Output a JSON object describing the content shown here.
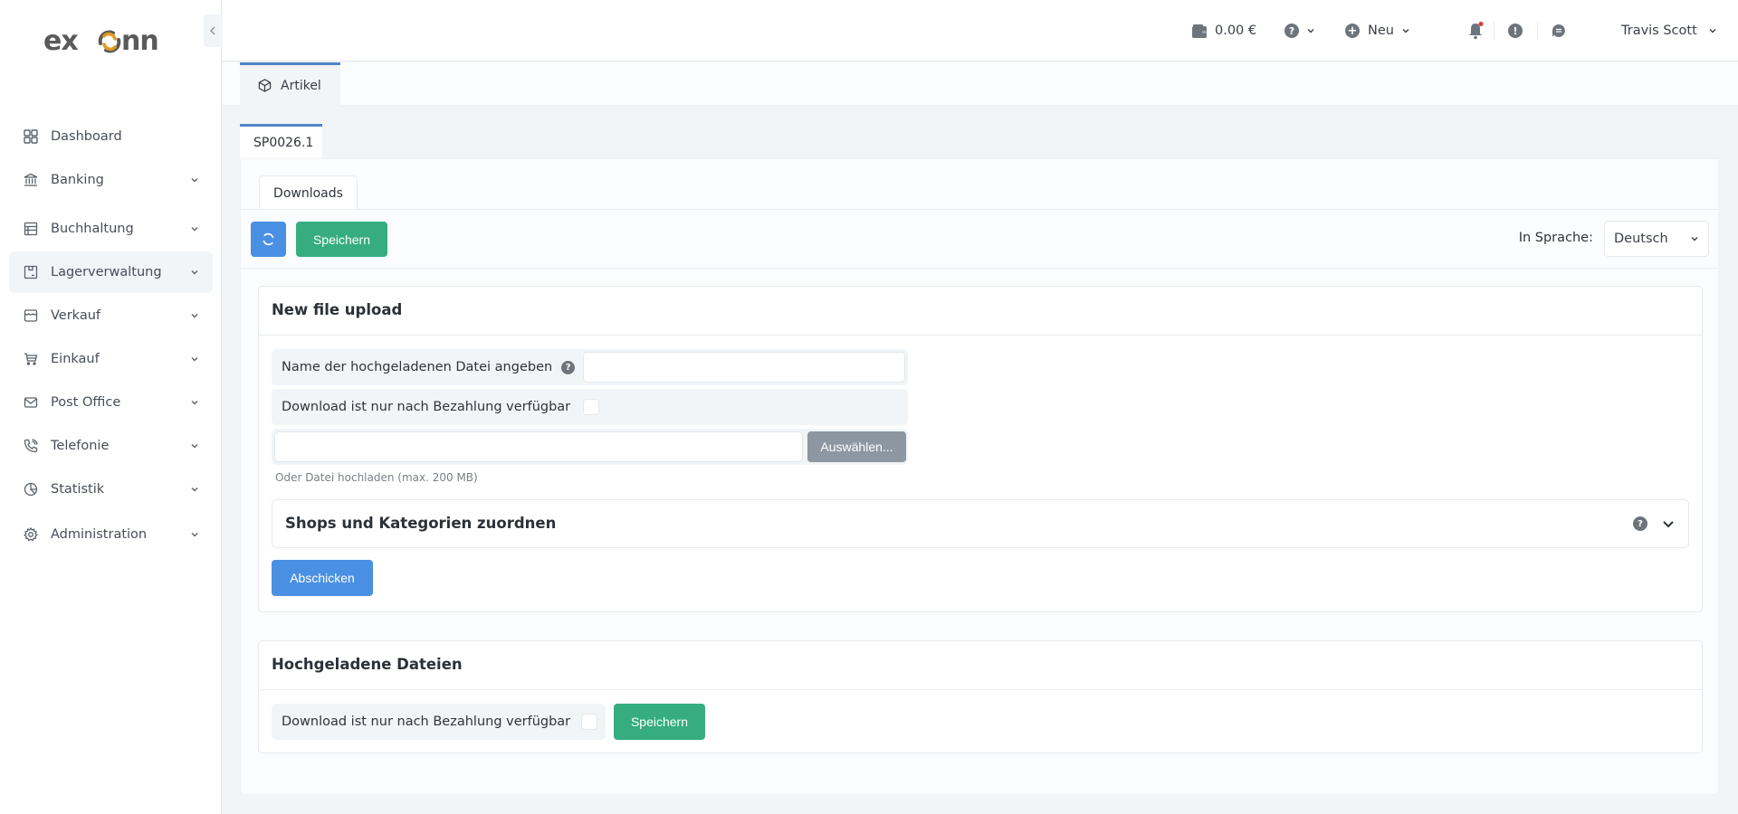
{
  "app": {
    "logo_text": "exonn",
    "brand_colors": {
      "logo_gray": "#5a5a5c",
      "logo_orange": "#e39a1c",
      "accent_blue": "#4a90e2",
      "success_green": "#35ad80"
    }
  },
  "sidebar": {
    "collapse_icon": "chevron-left-icon",
    "items": [
      {
        "label": "Dashboard",
        "icon": "grid-icon",
        "has_submenu": false,
        "active": false
      },
      {
        "label": "Banking",
        "icon": "bank-icon",
        "has_submenu": true,
        "active": false
      },
      {
        "label": "Buchhaltung",
        "icon": "ledger-icon",
        "has_submenu": true,
        "active": false
      },
      {
        "label": "Lagerverwaltung",
        "icon": "warehouse-box-icon",
        "has_submenu": true,
        "active": true
      },
      {
        "label": "Verkauf",
        "icon": "storefront-icon",
        "has_submenu": true,
        "active": false
      },
      {
        "label": "Einkauf",
        "icon": "cart-icon",
        "has_submenu": true,
        "active": false
      },
      {
        "label": "Post Office",
        "icon": "mail-icon",
        "has_submenu": true,
        "active": false
      },
      {
        "label": "Telefonie",
        "icon": "phone-icon",
        "has_submenu": true,
        "active": false
      },
      {
        "label": "Statistik",
        "icon": "pie-chart-icon",
        "has_submenu": true,
        "active": false
      },
      {
        "label": "Administration",
        "icon": "gear-icon",
        "has_submenu": true,
        "active": false
      }
    ]
  },
  "topbar": {
    "balance": "0.00 €",
    "help_icon": "question-circle-icon",
    "new_label": "Neu",
    "notification_has_badge": true,
    "user_name": "Travis Scott"
  },
  "tabs": {
    "main_tab": "Artikel",
    "sub_tab": "SP0026.1",
    "inner_tab": "Downloads"
  },
  "toolbar": {
    "save_label": "Speichern",
    "language_label": "In Sprache:",
    "language_value": "Deutsch"
  },
  "upload_card": {
    "title": "New file upload",
    "name_label": "Name der hochgeladenen Datei angeben",
    "name_value": "",
    "paid_only_label": "Download ist nur nach Bezahlung verfügbar",
    "paid_only_checked": false,
    "file_path_value": "",
    "choose_label": "Auswählen...",
    "hint": "Oder Datei hochladen (max. 200 MB)",
    "accordion_title": "Shops und Kategorien zuordnen",
    "submit_label": "Abschicken"
  },
  "uploaded_card": {
    "title": "Hochgeladene Dateien",
    "paid_only_label": "Download ist nur nach Bezahlung verfügbar",
    "paid_only_checked": false,
    "save_label": "Speichern"
  }
}
